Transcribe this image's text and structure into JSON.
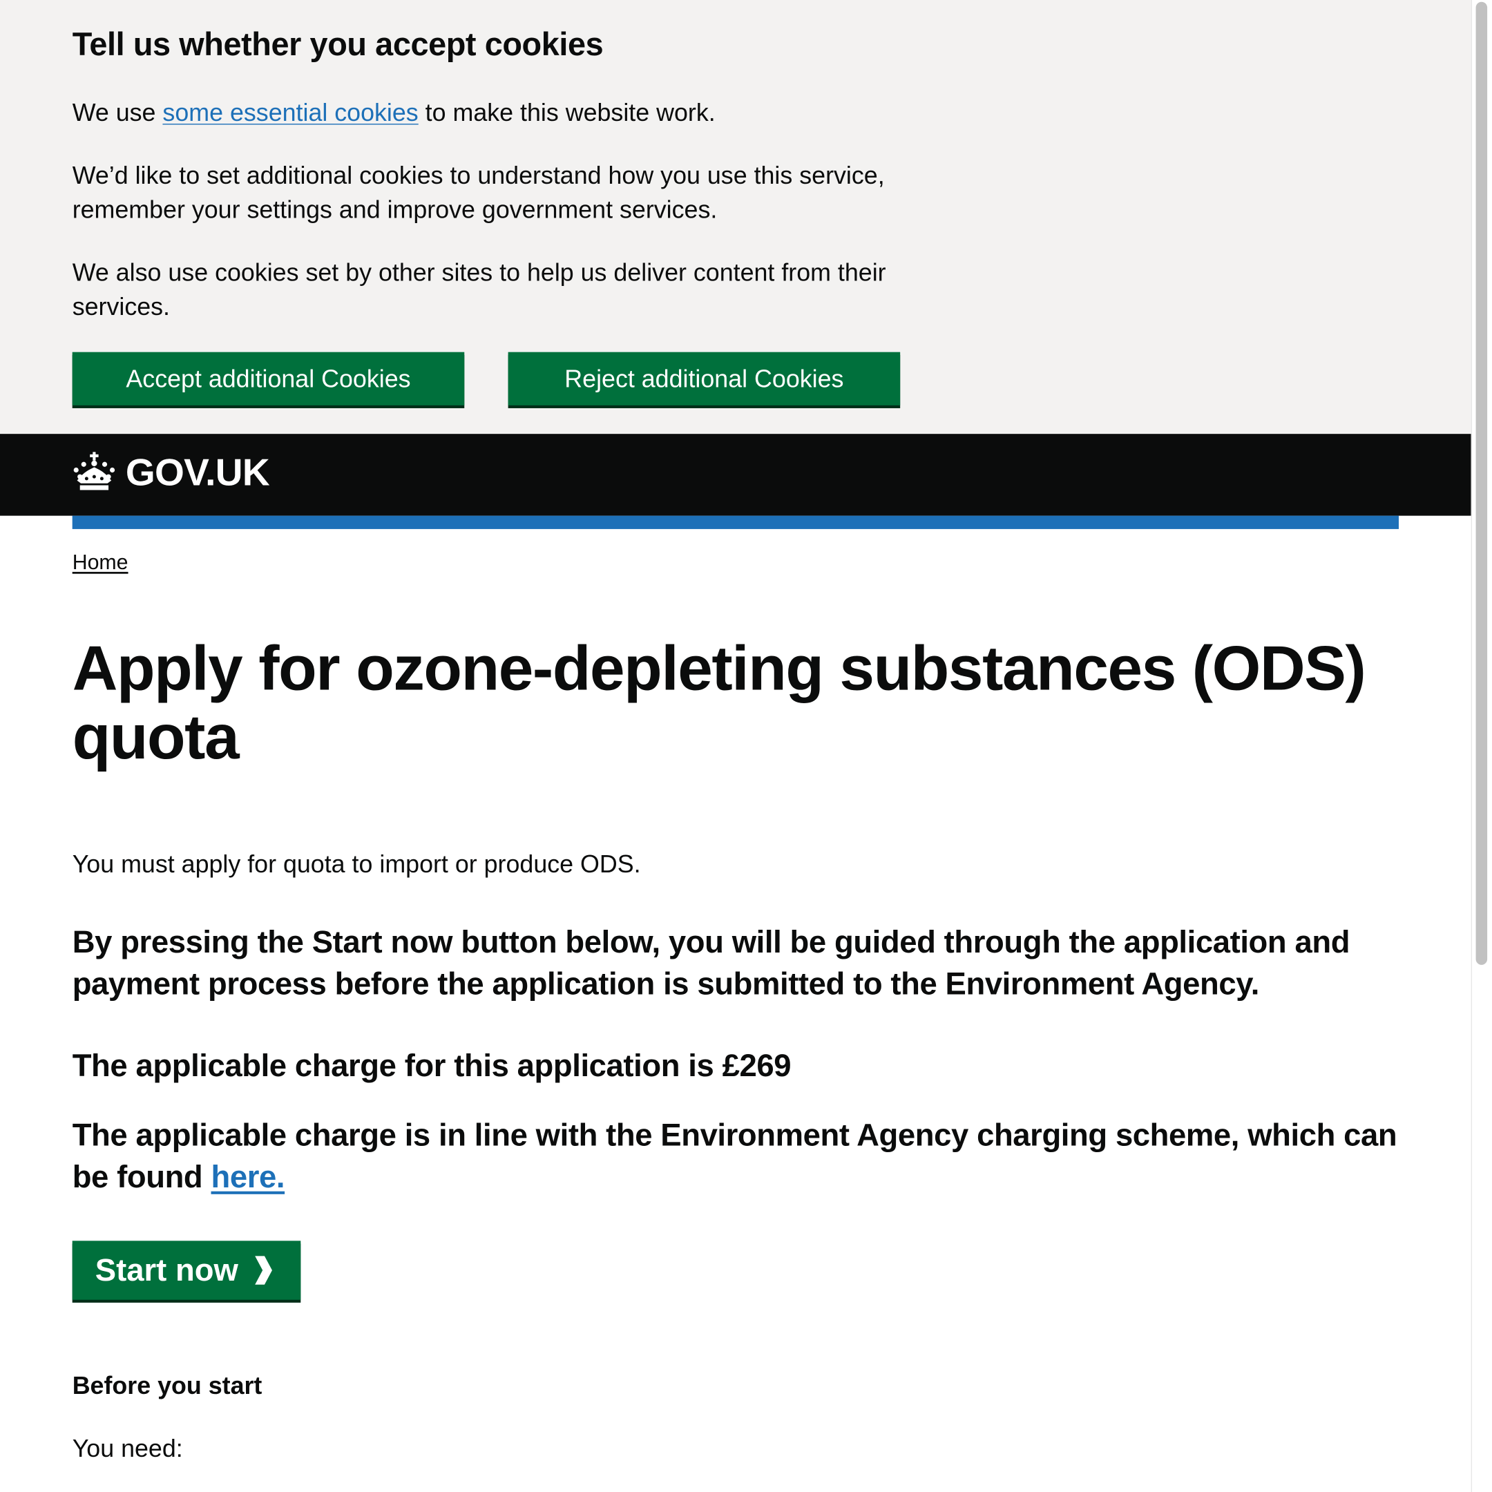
{
  "cookie_banner": {
    "title": "Tell us whether you accept cookies",
    "p1_prefix": "We use ",
    "p1_link": "some essential cookies",
    "p1_suffix": " to make this website work.",
    "p2": "We’d like to set additional cookies to understand how you use this service, remember your settings and improve government services.",
    "p3": "We also use cookies set by other sites to help us deliver content from their services.",
    "accept_label": "Accept additional Cookies",
    "reject_label": "Reject additional Cookies"
  },
  "header": {
    "logo_text": "GOV.UK",
    "logo_icon": "crown-icon"
  },
  "breadcrumb": {
    "home": "Home"
  },
  "main": {
    "title": "Apply for ozone-depleting substances (ODS) quota",
    "intro": "You must apply for quota to import or produce ODS.",
    "lead": "By pressing the Start now button below, you will be guided through the application and payment process before the application is submitted to the Environment Agency.",
    "charge": "The applicable charge for this application is £269",
    "scheme_text": "The applicable charge is in line with the Environment Agency charging scheme, which can be found ",
    "scheme_link": "here.",
    "start_label": "Start now",
    "start_icon": "chevron-right-icon",
    "before_heading": "Before you start",
    "you_need": "You need:"
  },
  "colors": {
    "button_green": "#00703c",
    "link_blue": "#1d70b8",
    "header_black": "#0b0c0c",
    "banner_grey": "#f3f2f1"
  }
}
